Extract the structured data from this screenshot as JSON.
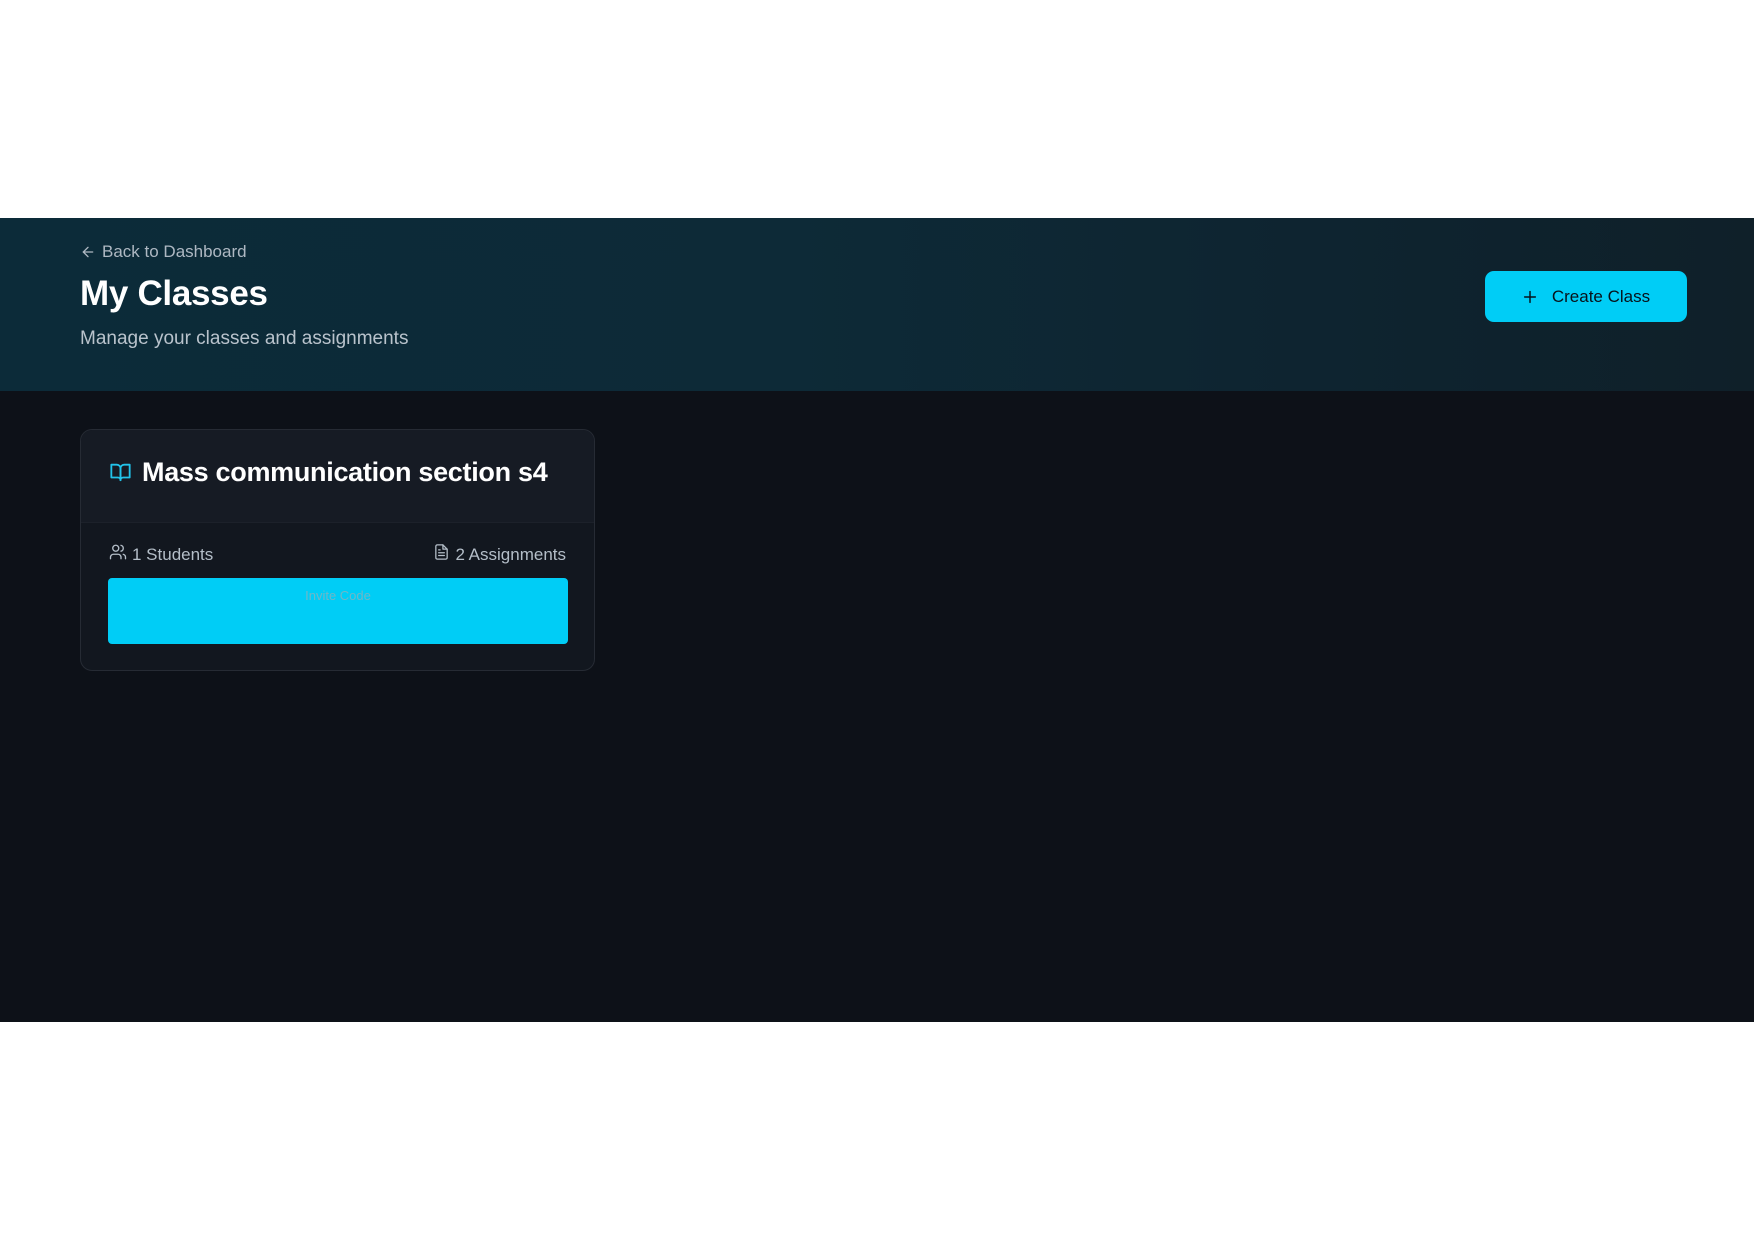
{
  "header": {
    "back_label": "Back to Dashboard",
    "title": "My Classes",
    "subtitle": "Manage your classes and assignments",
    "create_label": "Create Class"
  },
  "classes": [
    {
      "name": "Mass communication section s4",
      "students": "1 Students",
      "assignments": "2 Assignments",
      "invite_label": "Invite Code"
    }
  ],
  "icons": {
    "back": "arrow-left-icon",
    "create": "plus-icon",
    "class": "book-open-icon",
    "students": "users-icon",
    "assignments": "file-text-icon"
  },
  "colors": {
    "accent": "#00cdf6",
    "background": "#0d1118",
    "header_gradient_start": "#0c2b39",
    "header_gradient_end": "#0f2029",
    "card": "#12171f"
  }
}
